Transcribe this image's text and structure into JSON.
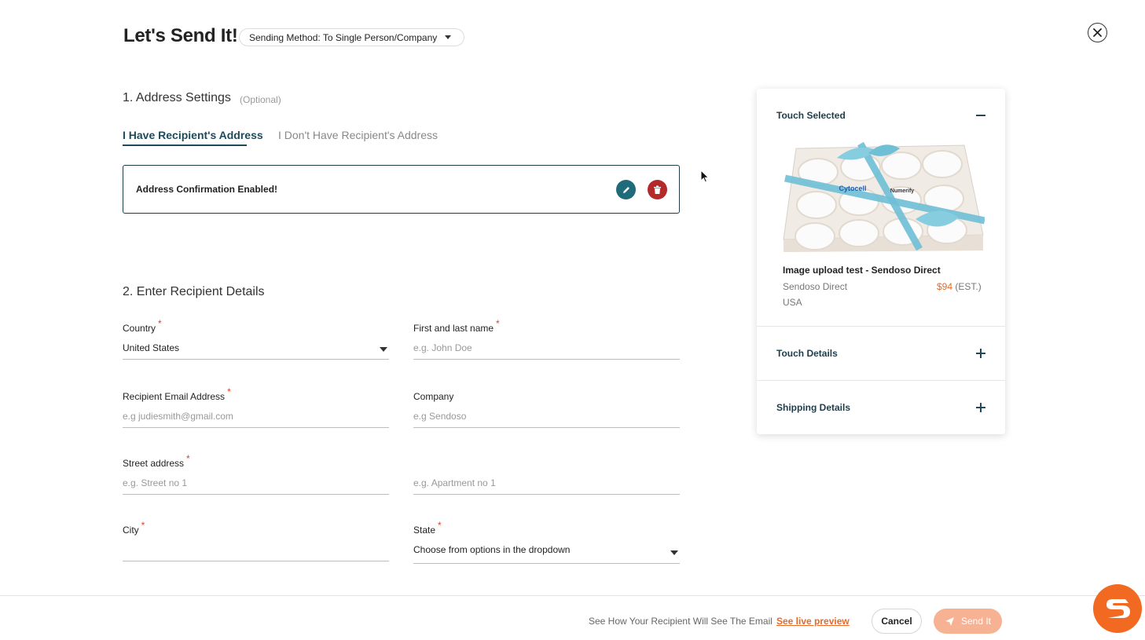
{
  "header": {
    "title": "Let's Send It!",
    "sending_method": "Sending Method: To Single Person/Company"
  },
  "section1": {
    "title": "1. Address Settings",
    "optional": "(Optional)",
    "tabs": [
      {
        "label": "I Have Recipient's Address",
        "active": true
      },
      {
        "label": "I Don't Have Recipient's Address",
        "active": false
      }
    ],
    "address_box_label": "Address Confirmation Enabled!"
  },
  "section2": {
    "title": "2. Enter Recipient Details",
    "fields": {
      "country": {
        "label": "Country",
        "value": "United States"
      },
      "name": {
        "label": "First and last name",
        "placeholder": "e.g. John Doe"
      },
      "email": {
        "label": "Recipient Email Address",
        "placeholder": "e.g judiesmith@gmail.com"
      },
      "company": {
        "label": "Company",
        "placeholder": "e.g Sendoso"
      },
      "street": {
        "label": "Street address",
        "placeholder": "e.g. Street no 1"
      },
      "apartment": {
        "placeholder": "e.g. Apartment no 1"
      },
      "city": {
        "label": "City"
      },
      "state": {
        "label": "State",
        "value": "Choose from options in the dropdown"
      }
    }
  },
  "panel": {
    "title": "Touch Selected",
    "product": {
      "name": "Image upload test - Sendoso Direct",
      "vendor": "Sendoso Direct",
      "price": "$94",
      "price_note": "(EST.)",
      "country": "USA",
      "cookie_labels": [
        "Cytocell",
        "Numerify"
      ]
    },
    "touch_details": "Touch Details",
    "shipping_details": "Shipping Details"
  },
  "footer": {
    "hint": "See How Your Recipient Will See The Email",
    "preview_link": "See live preview",
    "cancel": "Cancel",
    "send": "Send It"
  },
  "colors": {
    "accent_dark": "#1e4a5a",
    "brand_orange": "#f26a21",
    "price_orange": "#e8692a",
    "delete_red": "#b42a2a",
    "edit_teal": "#1f6b7a",
    "send_button_disabled": "#f7b193"
  }
}
